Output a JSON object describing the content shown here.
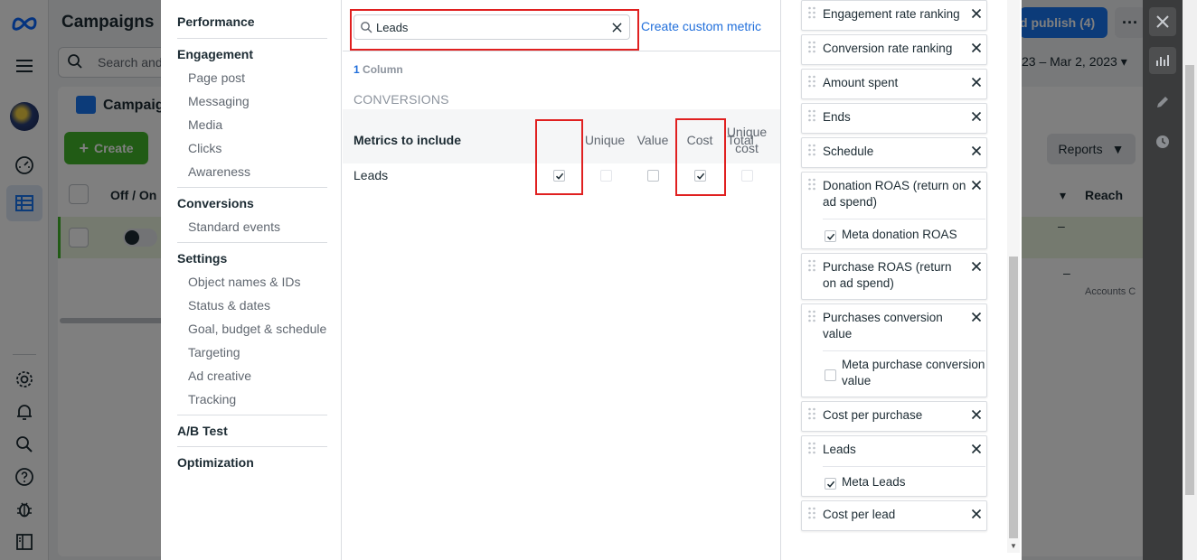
{
  "background": {
    "title": "Campaigns",
    "search_placeholder": "Search and",
    "campaigns_tab": "Campaign",
    "create_label": "Create",
    "off_on": "Off / On",
    "publish_label": "d publish (4)",
    "date_range": "23 – Mar 2, 2023",
    "reports_label": "Reports",
    "reach_label": "Reach",
    "accounts_text": "Accounts C",
    "dash": "–"
  },
  "categories": {
    "performance": "Performance",
    "engagement": "Engagement",
    "engagement_items": [
      "Page post",
      "Messaging",
      "Media",
      "Clicks",
      "Awareness"
    ],
    "conversions": "Conversions",
    "conversions_items": [
      "Standard events"
    ],
    "settings": "Settings",
    "settings_items": [
      "Object names & IDs",
      "Status & dates",
      "Goal, budget & schedule",
      "Targeting",
      "Ad creative",
      "Tracking"
    ],
    "ab_test": "A/B Test",
    "optimization": "Optimization"
  },
  "search": {
    "value": "Leads",
    "create_custom_metric": "Create custom metric"
  },
  "results": {
    "column_count": "1",
    "column_word": "Column",
    "section": "CONVERSIONS",
    "metrics_label": "Metrics to include",
    "headers": [
      "Total",
      "Unique",
      "Value",
      "Cost",
      "Unique cost"
    ],
    "row_label": "Leads",
    "row_checks": [
      true,
      false,
      false,
      true,
      false
    ]
  },
  "selected_columns": [
    {
      "label": "Engagement rate ranking"
    },
    {
      "label": "Conversion rate ranking"
    },
    {
      "label": "Amount spent"
    },
    {
      "label": "Ends"
    },
    {
      "label": "Schedule"
    },
    {
      "label": "Donation ROAS (return on ad spend)",
      "sub": "Meta donation ROAS",
      "sub_checked": true
    },
    {
      "label": "Purchase ROAS (return on ad spend)"
    },
    {
      "label": "Purchases conversion value",
      "sub": "Meta purchase conversion value",
      "sub_checked": false
    },
    {
      "label": "Cost per purchase"
    },
    {
      "label": "Leads",
      "sub": "Meta Leads",
      "sub_checked": true
    },
    {
      "label": "Cost per lead"
    }
  ],
  "colors": {
    "accent": "#216fdb",
    "highlight": "#e02020",
    "create_green": "#42b72a",
    "publish_blue": "#1877f2"
  }
}
